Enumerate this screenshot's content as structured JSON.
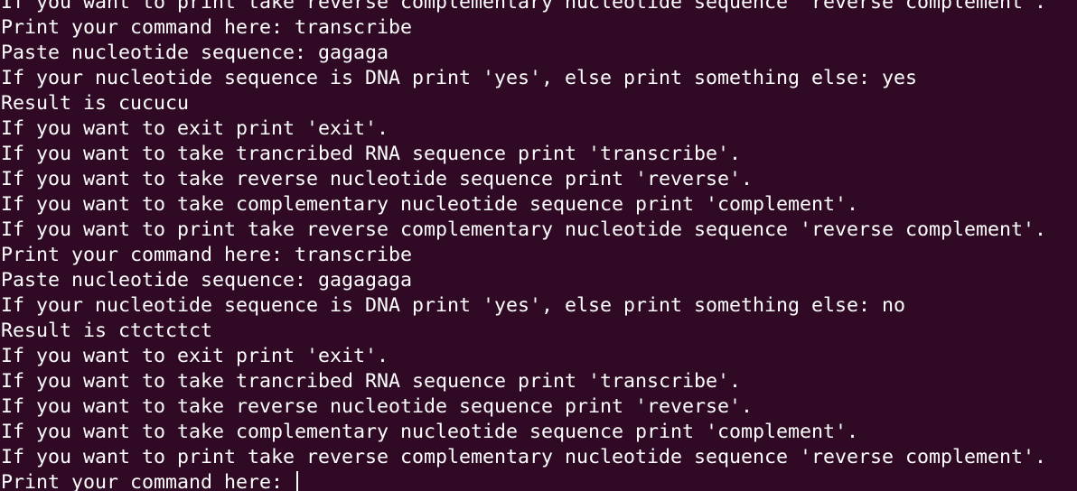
{
  "terminal": {
    "lines": [
      "If you want to print take reverse complementary nucleotide sequence 'reverse complement'.",
      "Print your command here: transcribe",
      "Paste nucleotide sequence: gagaga",
      "If your nucleotide sequence is DNA print 'yes', else print something else: yes",
      "Result is cucucu",
      "If you want to exit print 'exit'.",
      "If you want to take trancribed RNA sequence print 'transcribe'.",
      "If you want to take reverse nucleotide sequence print 'reverse'.",
      "If you want to take complementary nucleotide sequence print 'complement'.",
      "If you want to print take reverse complementary nucleotide sequence 'reverse complement'.",
      "Print your command here: transcribe",
      "Paste nucleotide sequence: gagagaga",
      "If your nucleotide sequence is DNA print 'yes', else print something else: no",
      "Result is ctctctct",
      "If you want to exit print 'exit'.",
      "If you want to take trancribed RNA sequence print 'transcribe'.",
      "If you want to take reverse nucleotide sequence print 'reverse'.",
      "If you want to take complementary nucleotide sequence print 'complement'.",
      "If you want to print take reverse complementary nucleotide sequence 'reverse complement'."
    ],
    "prompt": "Print your command here: ",
    "colors": {
      "background": "#300a24",
      "text": "#ffffff"
    }
  }
}
